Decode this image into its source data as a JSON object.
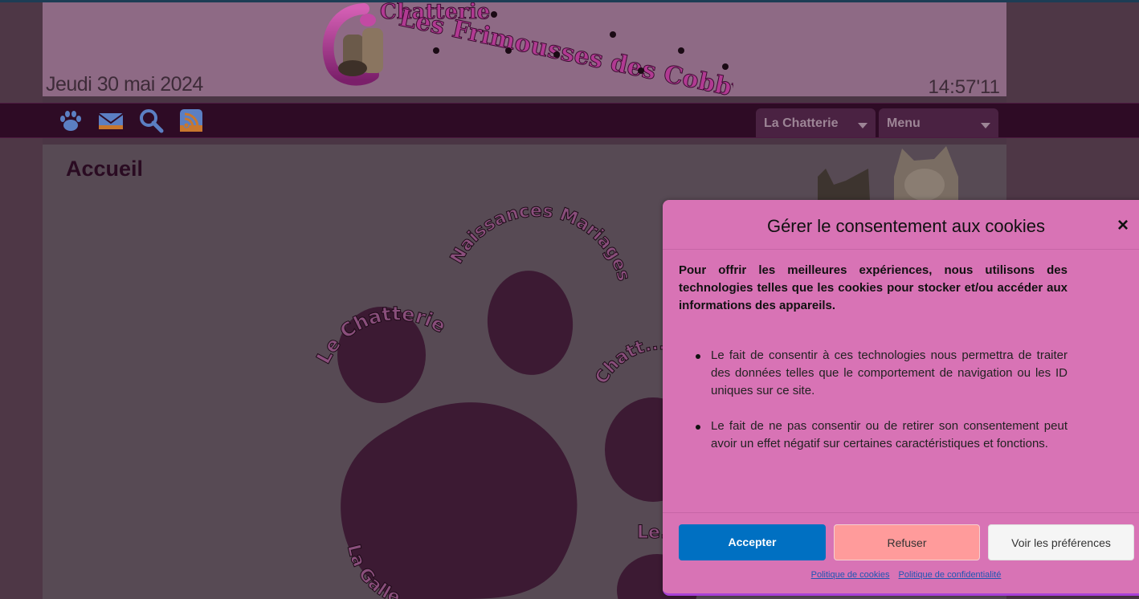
{
  "header": {
    "logo_text": "Les Frimousses des Cobby Cats",
    "logo_subtitle": "Chatterie",
    "date": "Jeudi 30 mai 2024",
    "time": "14:57'11"
  },
  "navbar": {
    "icons": [
      "paw-icon",
      "mail-icon",
      "search-icon",
      "rss-icon"
    ],
    "dropdown_1": "La Chatterie",
    "dropdown_2": "Menu"
  },
  "content": {
    "title": "Accueil",
    "paw_labels": [
      "Le Chatterie",
      "Naissances Mariages",
      "Chatt... ...oe",
      "La Galle...",
      "Le..."
    ]
  },
  "cookie": {
    "title": "Gérer le consentement aux cookies",
    "close": "×",
    "intro": "Pour offrir les meilleures expériences, nous utilisons des technologies telles que les cookies pour stocker et/ou accéder aux informations des appareils.",
    "items": [
      "Le fait de consentir à ces technologies nous permettra de traiter des données telles que le comportement de navigation ou les ID uniques sur ce site.",
      "Le fait de ne pas consentir ou de retirer son consentement peut avoir un effet négatif sur certaines caractéristiques et fonctions."
    ],
    "accept": "Accepter",
    "refuse": "Refuser",
    "preferences": "Voir les préférences",
    "link_cookies": "Politique de cookies",
    "link_privacy": "Politique de confidentialité"
  },
  "colors": {
    "dialog_bg": "#d873b5",
    "accept_bg": "#0070c2",
    "refuse_bg": "#ff9b9b",
    "navbar_bg": "#2e0b25"
  }
}
